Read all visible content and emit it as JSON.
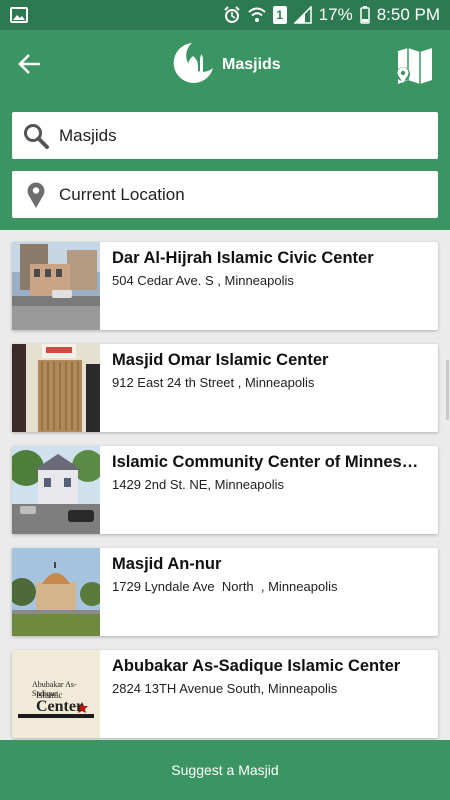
{
  "status_bar": {
    "battery_percent": "17%",
    "time": "8:50 PM",
    "sim_label": "1",
    "icons": [
      "image-icon",
      "alarm-icon",
      "wifi-icon",
      "sim-icon",
      "signal-icon",
      "battery-icon"
    ]
  },
  "app_bar": {
    "title": "Masjids",
    "back_icon": "back-arrow-icon",
    "logo_icon": "crescent-mosque-icon",
    "map_icon": "map-icon"
  },
  "search": {
    "query_value": "Masjids",
    "location_value": "Current Location",
    "search_icon": "search-icon",
    "location_icon": "location-pin-icon"
  },
  "masjids": [
    {
      "name": "Dar Al-Hijrah Islamic Civic Center",
      "address": "504 Cedar Ave. S , Minneapolis"
    },
    {
      "name": "Masjid Omar Islamic Center",
      "address": "912 East 24 th Street , Minneapolis"
    },
    {
      "name": "Islamic Community Center of Minnesota",
      "address": "1429 2nd St. NE, Minneapolis"
    },
    {
      "name": "Masjid An-nur",
      "address": "1729 Lyndale Ave  North  , Minneapolis"
    },
    {
      "name": "Abubakar As-Sadique Islamic Center",
      "address": "2824 13TH Avenue South, Minneapolis"
    }
  ],
  "thumb_logo": {
    "line1": "Abubakar As-Sadique",
    "line2": "Islamic",
    "line3": "Center"
  },
  "footer": {
    "suggest_label": "Suggest a Masjid"
  },
  "colors": {
    "primary": "#3b9563",
    "status_bar": "#2d7a52"
  }
}
